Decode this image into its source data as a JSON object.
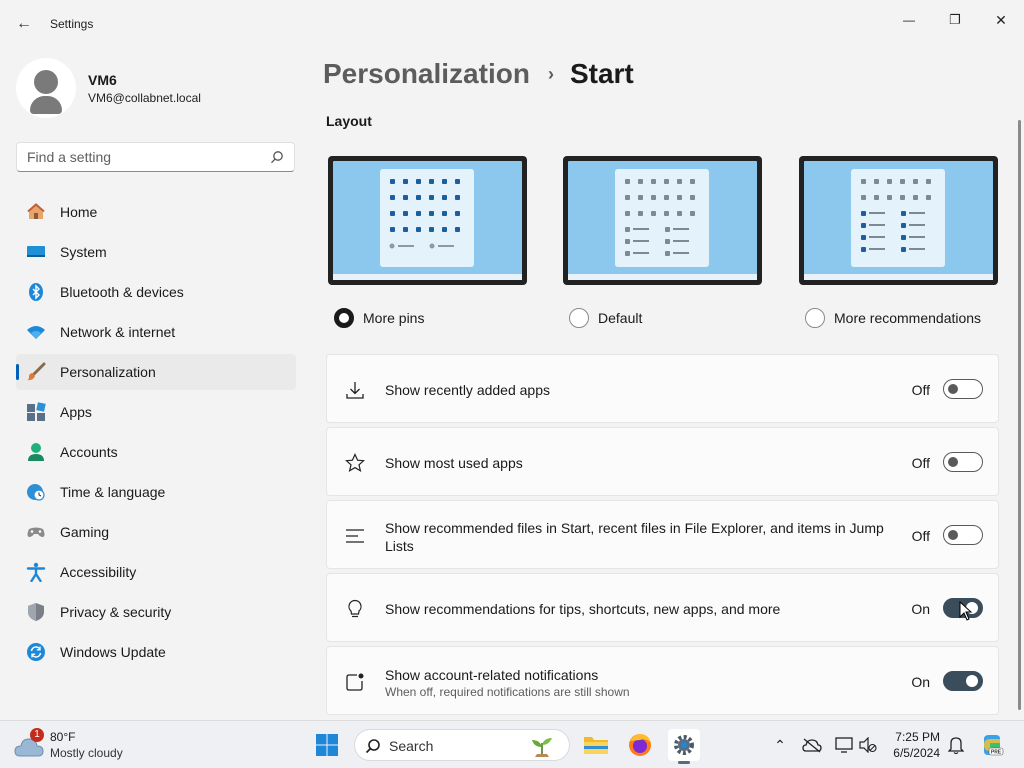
{
  "window": {
    "title": "Settings",
    "minimize_glyph": "—",
    "maximize_glyph": "❐",
    "close_glyph": "✕",
    "back_glyph": "←"
  },
  "profile": {
    "name": "VM6",
    "email": "VM6@collabnet.local"
  },
  "search": {
    "placeholder": "Find a setting"
  },
  "sidebar": {
    "items": [
      {
        "label": "Home",
        "icon": "home-icon"
      },
      {
        "label": "System",
        "icon": "system-icon"
      },
      {
        "label": "Bluetooth & devices",
        "icon": "bluetooth-icon"
      },
      {
        "label": "Network & internet",
        "icon": "wifi-icon"
      },
      {
        "label": "Personalization",
        "icon": "brush-icon",
        "active": true
      },
      {
        "label": "Apps",
        "icon": "apps-icon"
      },
      {
        "label": "Accounts",
        "icon": "accounts-icon"
      },
      {
        "label": "Time & language",
        "icon": "clock-globe-icon"
      },
      {
        "label": "Gaming",
        "icon": "gamepad-icon"
      },
      {
        "label": "Accessibility",
        "icon": "accessibility-icon"
      },
      {
        "label": "Privacy & security",
        "icon": "shield-icon"
      },
      {
        "label": "Windows Update",
        "icon": "update-icon"
      }
    ]
  },
  "breadcrumb": {
    "parent": "Personalization",
    "separator": "›",
    "current": "Start"
  },
  "layout": {
    "title": "Layout",
    "options": [
      {
        "label": "More pins",
        "selected": true
      },
      {
        "label": "Default",
        "selected": false
      },
      {
        "label": "More recommendations",
        "selected": false
      }
    ]
  },
  "settings": [
    {
      "label": "Show recently added apps",
      "state": "Off",
      "on": false,
      "icon": "download-icon"
    },
    {
      "label": "Show most used apps",
      "state": "Off",
      "on": false,
      "icon": "star-icon"
    },
    {
      "label": "Show recommended files in Start, recent files in File Explorer, and items in Jump Lists",
      "state": "Off",
      "on": false,
      "icon": "list-icon"
    },
    {
      "label": "Show recommendations for tips, shortcuts, new apps, and more",
      "state": "On",
      "on": true,
      "icon": "lightbulb-icon"
    },
    {
      "label": "Show account-related notifications",
      "sublabel": "When off, required notifications are still shown",
      "state": "On",
      "on": true,
      "icon": "notification-icon"
    }
  ],
  "taskbar": {
    "weather_badge": "1",
    "temperature": "80°F",
    "condition": "Mostly cloudy",
    "search_label": "Search",
    "time": "7:25 PM",
    "date": "6/5/2024",
    "tray_chevron": "⌃"
  },
  "colors": {
    "accent": "#005fb8",
    "toggle_on": "#3b4c5a",
    "window_bg": "#f3f3f3",
    "card_bg": "#fbfbfb"
  }
}
